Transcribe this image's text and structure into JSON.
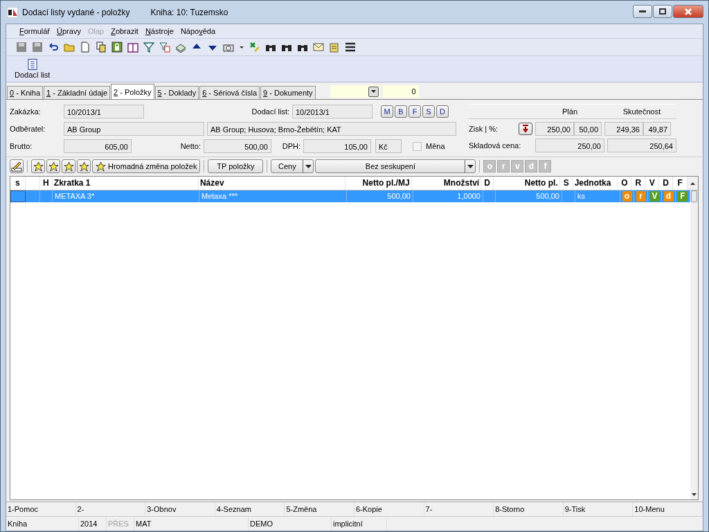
{
  "window": {
    "title": "Dodací listy vydané - položky",
    "subtitle": "Kniha: 10: Tuzemsko"
  },
  "menu": [
    {
      "key": "F",
      "after": "ormulář",
      "disabled": false
    },
    {
      "key": "Ú",
      "after": "pravy",
      "disabled": false
    },
    {
      "after": "Olap",
      "disabled": true
    },
    {
      "key": "Z",
      "after": "obrazit",
      "disabled": false
    },
    {
      "key": "N",
      "after": "ástroje",
      "disabled": false
    },
    {
      "before": "Nápo",
      "key": "v",
      "after": "ěda",
      "disabled": false
    }
  ],
  "big_button": {
    "label": "Dodací list"
  },
  "tabs": [
    {
      "key": "0",
      "label": " - Kniha",
      "selected": false
    },
    {
      "key": "1",
      "label": " - Základní údaje",
      "selected": false
    },
    {
      "key": "2",
      "label": " - Položky",
      "selected": true
    },
    {
      "key": "5",
      "label": " - Doklady",
      "selected": false
    },
    {
      "key": "6",
      "label": " - Sériová čísla",
      "selected": false
    },
    {
      "key": "9",
      "label": " - Dokumenty",
      "selected": false
    }
  ],
  "tab_counter": "0",
  "form": {
    "zakazka_label": "Zakázka:",
    "zakazka": "10/2013/1",
    "dodaci_label": "Dodací list:",
    "dodaci": "10/2013/1",
    "doc_buttons": [
      "M",
      "B",
      "F",
      "S",
      "D"
    ],
    "odberatel_label": "Odběratel:",
    "odberatel": "AB Group",
    "odberatel_address": "AB Group; Husova; Brno-Žebětín; KAT",
    "brutto_label": "Brutto:",
    "brutto": "605,00",
    "netto_label": "Netto:",
    "netto": "500,00",
    "dph_label": "DPH:",
    "dph": "105,00",
    "currency": "Kč",
    "mena": {
      "label": "Měna",
      "checked": false
    }
  },
  "profit": {
    "plan_label": "Plán",
    "actual_label": "Skutečnost",
    "zisk_label": "Zisk | %:",
    "plan_zisk": "250,00",
    "plan_pct": "50,00",
    "actual_zisk": "249,36",
    "actual_pct": "49,87",
    "sklad_label": "Skladová cena:",
    "plan_sklad": "250,00",
    "actual_sklad": "250,64"
  },
  "items_toolbar": {
    "mass_change": "Hromadná změna položek",
    "tp": "TP položky",
    "prices": "Ceny",
    "grouping": "Bez seskupení",
    "letters": [
      "o",
      "r",
      "v",
      "d",
      "f"
    ]
  },
  "table": {
    "columns": [
      {
        "kind": "text",
        "label": "s"
      },
      {
        "kind": "blank"
      },
      {
        "kind": "text",
        "label": "H"
      },
      {
        "kind": "text",
        "label": "Zkratka 1"
      },
      {
        "kind": "text",
        "label": "Název"
      },
      {
        "kind": "text",
        "label": "Netto pl./MJ"
      },
      {
        "kind": "text",
        "label": "Množství"
      },
      {
        "kind": "text",
        "label": "D"
      },
      {
        "kind": "text",
        "label": "Netto pl."
      },
      {
        "kind": "text",
        "label": "S"
      },
      {
        "kind": "text",
        "label": "Jednotka"
      },
      {
        "kind": "text",
        "label": "O"
      },
      {
        "kind": "text",
        "label": "R"
      },
      {
        "kind": "text",
        "label": "V"
      },
      {
        "kind": "text",
        "label": "D"
      },
      {
        "kind": "text",
        "label": "F"
      }
    ],
    "rows": [
      {
        "selected": true,
        "zkratka": "METAXA 3*",
        "nazev": "Metaxa ***",
        "netto_mj": "500,00",
        "mnozstvi": "1,0000",
        "netto": "500,00",
        "jednotka": "ks",
        "flags": [
          {
            "text": "o",
            "color": "#f08c00"
          },
          {
            "text": "r",
            "color": "#f08c00"
          },
          {
            "text": "V",
            "color": "#5a9e1e"
          },
          {
            "text": "d",
            "color": "#f08c00"
          },
          {
            "text": "F",
            "color": "#5a9e1e"
          }
        ]
      }
    ]
  },
  "function_keys": [
    "1-Pomoc",
    "2-",
    "3-Obnov",
    "4-Seznam",
    "5-Změna",
    "6-Kopie",
    "7-",
    "8-Storno",
    "9-Tisk",
    "10-Menu"
  ],
  "status_bar": [
    {
      "text": "Kniha",
      "disabled": false
    },
    {
      "text": "2014",
      "disabled": false
    },
    {
      "text": "PŘES",
      "disabled": true
    },
    {
      "text": "MAT",
      "disabled": false
    },
    {
      "text": "DEMO",
      "disabled": false
    },
    {
      "text": "implicitní",
      "disabled": false
    }
  ]
}
